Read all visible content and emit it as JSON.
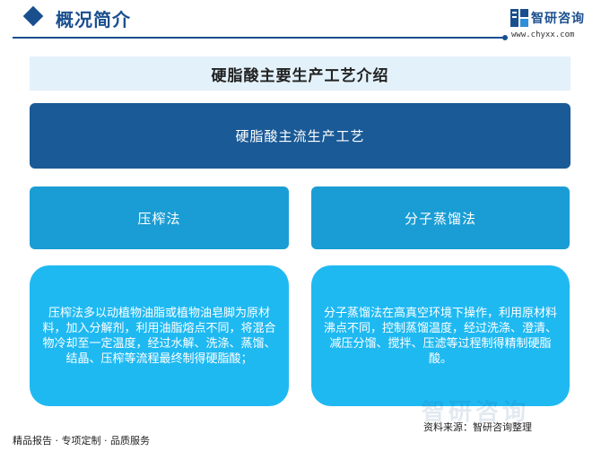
{
  "header": {
    "title": "概况简介",
    "brand_name": "智研咨询",
    "brand_url": "www.chyxx.com"
  },
  "main_title": "硬脂酸主要生产工艺介绍",
  "process_title": "硬脂酸主流生产工艺",
  "methods": [
    {
      "name": "压榨法",
      "description": "压榨法多以动植物油脂或植物油皂脚为原材料，加入分解剂，利用油脂熔点不同，将混合物冷却至一定温度，经过水解、洗涤、蒸馏、结晶、压榨等流程最终制得硬脂酸；"
    },
    {
      "name": "分子蒸馏法",
      "description": "分子蒸馏法在高真空环境下操作，利用原材料沸点不同，控制蒸馏温度，经过洗涤、澄清、减压分馏、搅拌、压滤等过程制得精制硬脂酸。"
    }
  ],
  "watermark": "智研咨询",
  "footer": {
    "left": "精品报告 · 专项定制 · 品质服务",
    "source": "资料来源：智研咨询整理"
  },
  "colors": {
    "brand_dark": "#1a4f8e",
    "process": "#1a5a96",
    "method": "#1a9dd4",
    "panel": "#1fb9f2",
    "title_bg": "#e3f1fb"
  }
}
